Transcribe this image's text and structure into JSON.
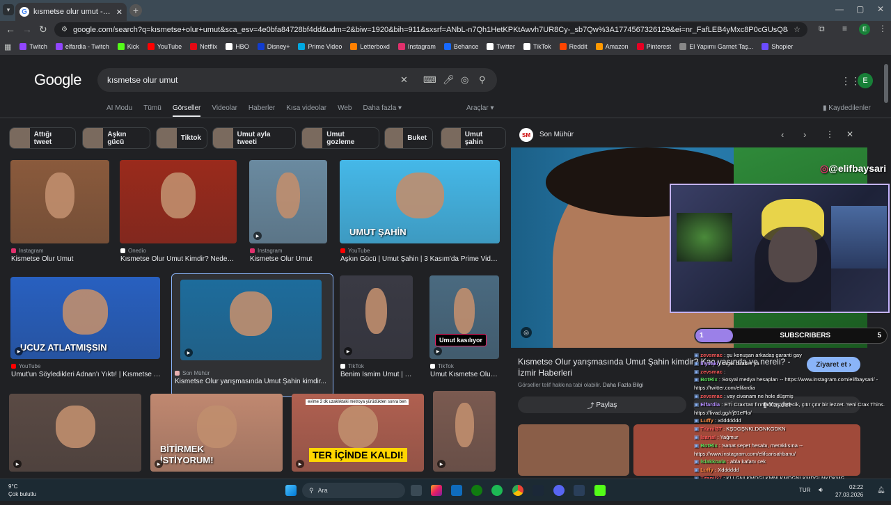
{
  "browser": {
    "tab_title": "kısmetse olur umut - Google'da...",
    "url": "google.com/search?q=kısmetse+olur+umut&sca_esv=4e0bfa84728bf4dd&udm=2&biw=1920&bih=911&sxsrf=ANbL-n7Qh1HetKPKtAwvh7UR8Cy-_sb7Qw%3A1774567326129&ei=nr_FafLEB4yMxc8P0cGUsQ8&ved=0ahUKEwjyi-q4z6TAxUMRvEDH...",
    "profile_initial": "E",
    "bookmarks": [
      {
        "label": "Twitch",
        "color": "#9146ff"
      },
      {
        "label": "elfardia - Twitch",
        "color": "#9146ff"
      },
      {
        "label": "Kick",
        "color": "#53fc18"
      },
      {
        "label": "YouTube",
        "color": "#ff0000"
      },
      {
        "label": "Netflix",
        "color": "#e50914"
      },
      {
        "label": "HBO",
        "color": "#ffffff"
      },
      {
        "label": "Disney+",
        "color": "#113ccf"
      },
      {
        "label": "Prime Video",
        "color": "#00a8e1"
      },
      {
        "label": "Letterboxd",
        "color": "#ff8000"
      },
      {
        "label": "Instagram",
        "color": "#e1306c"
      },
      {
        "label": "Behance",
        "color": "#1769ff"
      },
      {
        "label": "Twitter",
        "color": "#ffffff"
      },
      {
        "label": "TikTok",
        "color": "#ffffff"
      },
      {
        "label": "Reddit",
        "color": "#ff4500"
      },
      {
        "label": "Amazon",
        "color": "#ff9900"
      },
      {
        "label": "Pinterest",
        "color": "#e60023"
      },
      {
        "label": "El Yapımı Garnet Taş...",
        "color": "#888888"
      },
      {
        "label": "Shopier",
        "color": "#6b4cff"
      }
    ]
  },
  "google": {
    "logo": "Google",
    "query": "kısmetse olur umut",
    "profile_initial": "E",
    "nav_tabs": [
      "AI Modu",
      "Tümü",
      "Görseller",
      "Videolar",
      "Haberler",
      "Kısa videolar",
      "Web",
      "Daha fazla"
    ],
    "active_tab": "Görseller",
    "tools": "Araçlar",
    "saved": "Kaydedilenler",
    "chips": [
      "Attığı tweet",
      "Aşkın gücü",
      "Tiktok",
      "Umut ayla tweeti",
      "Umut gozleme",
      "Buket",
      "Umut şahin"
    ]
  },
  "results": [
    {
      "source": "Instagram",
      "title": "Kismetse Olur Umut",
      "src_color": "#e1306c",
      "bg": "#8a5a3c"
    },
    {
      "source": "Onedio",
      "title": "Kısmetse Olur Umut Kimdir? Neden ...",
      "src_color": "#ffffff",
      "bg": "#9a2a1c"
    },
    {
      "source": "Instagram",
      "title": "Kismetse Olur Umut",
      "src_color": "#e1306c",
      "bg": "#6a8aa0"
    },
    {
      "source": "YouTube",
      "title": "Aşkın Gücü | Umut Şahin | 3 Kasım'da Prime Video...",
      "src_color": "#ff0000",
      "bg": "#45b8e8",
      "overlay": "UMUT ŞAHİN"
    },
    {
      "source": "YouTube",
      "title": "Umut'un Söyledikleri Adnan'ı Yıktı! | Kısmetse O...",
      "src_color": "#ff0000",
      "bg": "#2860c0",
      "overlay": "UCUZ ATLATMIŞSIN"
    },
    {
      "source": "Son Mühür",
      "title": "Kismetse Olur yarışmasında Umut Şahin kimdir...",
      "src_color": "#e8b0b0",
      "bg": "#1d6c9c"
    },
    {
      "source": "TikTok",
      "title": "Benim Ismim Umut | Tik...",
      "src_color": "#ffffff",
      "bg": "#3a3a44"
    },
    {
      "source": "TikTok",
      "title": "Umut Kısmetse Olur ...",
      "src_color": "#ffffff",
      "bg": "#4a6a80",
      "overlay": "Umut kasılıyor"
    },
    {
      "bg": "#5a4a44"
    },
    {
      "bg": "#c08870",
      "overlay": "BİTİRMEK İSTİYORUM!"
    },
    {
      "bg": "#b06050",
      "overlay": "TER İÇİNDE KALDI!",
      "caption": "evime 3 dk uzaklıktaki metroya yürüdükten sonra ben"
    },
    {
      "bg": "#7a5a50"
    }
  ],
  "panel": {
    "source": "Son Mühür",
    "title": "Kısmetse Olur yarışmasında Umut Şahin kimdir? Kaç yaşında ve nereli? - İzmir Haberleri",
    "visit": "Ziyaret et",
    "note": "Görseller telif hakkına tabi olabilir.",
    "note_link": "Daha Fazla Bilgi",
    "share": "Paylaş",
    "save": "Kaydet"
  },
  "stream": {
    "handle": "@elifbaysari",
    "sub_count_left": "1",
    "sub_label": "SUBSCRIBERS",
    "sub_count_right": "5",
    "sub_progress": 0.2,
    "chat": [
      {
        "user": "zevsmac",
        "text": ": şu konuşan arkadaş garanti gay",
        "color": "#ff5a5a"
      },
      {
        "user": "lilyvaki",
        "text": ": bırak birader ya",
        "color": "#b38cff"
      },
      {
        "user": "zevsmac",
        "text": ":",
        "color": "#ff5a5a"
      },
      {
        "user": "BotRix",
        "text": ": Sosyal medya hesapları -- https://www.instagram.com/elifbaysari/ - https://twitter.com/elifardia",
        "color": "#5adc5a"
      },
      {
        "user": "zevsmac",
        "text": ": vay civanam ne hole düşmiş",
        "color": "#ff5a5a"
      },
      {
        "user": "Elfardia",
        "text": ": ETİ Crax'tan fırınlanmış, incecik, çıtır çıtır bir lezzet. Yeni Crax Thins. https://livad.gg/r/j91eFlo/",
        "color": "#b38cff"
      },
      {
        "user": "Luffy",
        "text": ": xddddddd",
        "color": "#ff8c42"
      },
      {
        "user": "Titanil37",
        "text": ": KŞDGŞNKLDGNKGDKN",
        "color": "#ff5a5a"
      },
      {
        "user": "lsarial",
        "text": ": Yağmur",
        "color": "#ff5a5a"
      },
      {
        "user": "BotRix",
        "text": ": Sanat sepet hesabı, meraklısına -- https://www.instagram.com/elifcarisahbanu/",
        "color": "#5adc5a"
      },
      {
        "user": "lslakkoala",
        "text": ": abla kafanı cek",
        "color": "#5adc5a"
      },
      {
        "user": "Luffy",
        "text": ": Xdddddd",
        "color": "#ff8c42"
      },
      {
        "user": "Titanil37",
        "text": ": KLLGNLKMDGLKMNLKMDGNLKMDGLNKDKMG",
        "color": "#ff5a5a"
      }
    ]
  },
  "taskbar": {
    "temp": "9°C",
    "weather": "Çok bulutlu",
    "search": "Ara",
    "lang": "TUR",
    "time": "02:22",
    "date": "27.03.2026"
  }
}
